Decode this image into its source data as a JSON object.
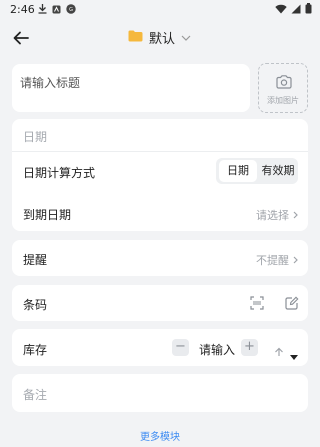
{
  "status_bar": {
    "time": "2:46"
  },
  "header": {
    "folder_name": "默认"
  },
  "title_field": {
    "placeholder": "请输入标题"
  },
  "photo": {
    "label": "添加图片"
  },
  "date_section": {
    "header": "日期",
    "calc_label": "日期计算方式",
    "calc_options": [
      "日期",
      "有效期"
    ],
    "calc_selected": "日期",
    "expiry_label": "到期日期",
    "expiry_value": "请选择"
  },
  "reminder": {
    "label": "提醒",
    "value": "不提醒"
  },
  "barcode": {
    "label": "条码"
  },
  "stock": {
    "label": "库存",
    "minus": "−",
    "value": "请输入",
    "plus": "+"
  },
  "note": {
    "placeholder": "备注"
  },
  "footer": {
    "more_label": "更多模块"
  },
  "colors": {
    "accent": "#3d8bf2",
    "folder": "#f5b83d",
    "background": "#f2f3f5"
  }
}
